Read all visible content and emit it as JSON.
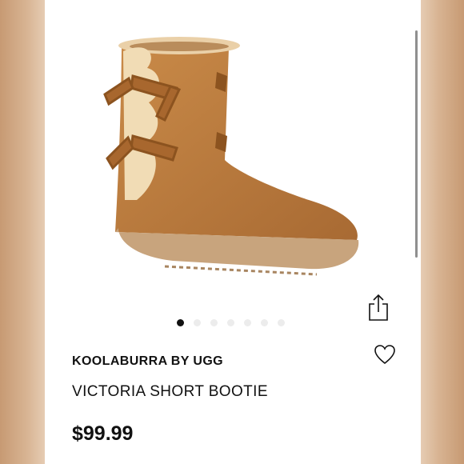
{
  "product": {
    "brand": "KOOLABURRA BY UGG",
    "name": "VICTORIA SHORT BOOTIE",
    "price": "$99.99"
  },
  "carousel": {
    "total": 7,
    "active": 0
  },
  "icons": {
    "share": "share-icon",
    "favorite": "heart-icon"
  },
  "colors": {
    "suede": "#b87a3f",
    "fur": "#f1dcb5",
    "sole": "#c8a47d"
  }
}
